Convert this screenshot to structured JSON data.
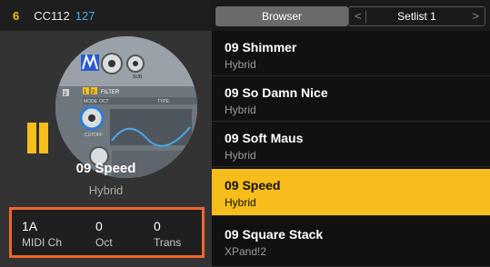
{
  "status": {
    "channel": "6",
    "cc_label": "CC112",
    "cc_value": "127"
  },
  "patch": {
    "name": "09 Speed",
    "type": "Hybrid",
    "art_labels": [
      "1",
      "2",
      "FILTER",
      "MODE",
      "OCT",
      "CUTOFF",
      "SUB",
      "TYPE"
    ]
  },
  "midi": {
    "channel": {
      "value": "1A",
      "label": "MIDI Ch"
    },
    "octave": {
      "value": "0",
      "label": "Oct"
    },
    "transpose": {
      "value": "0",
      "label": "Trans"
    }
  },
  "tabs": {
    "browser": "Browser",
    "setlist": "Setlist 1",
    "prev": "<",
    "next": ">"
  },
  "patches": [
    {
      "name": "09 Shimmer",
      "type": "Hybrid"
    },
    {
      "name": "09 So Damn Nice",
      "type": "Hybrid"
    },
    {
      "name": "09 Soft Maus",
      "type": "Hybrid"
    },
    {
      "name": "09 Speed",
      "type": "Hybrid"
    },
    {
      "name": "09 Square Stack",
      "type": "XPand!2"
    }
  ],
  "colors": {
    "accent": "#f6bd1c",
    "highlight_border": "#f0662c",
    "cc_value": "#4aa8e8"
  }
}
